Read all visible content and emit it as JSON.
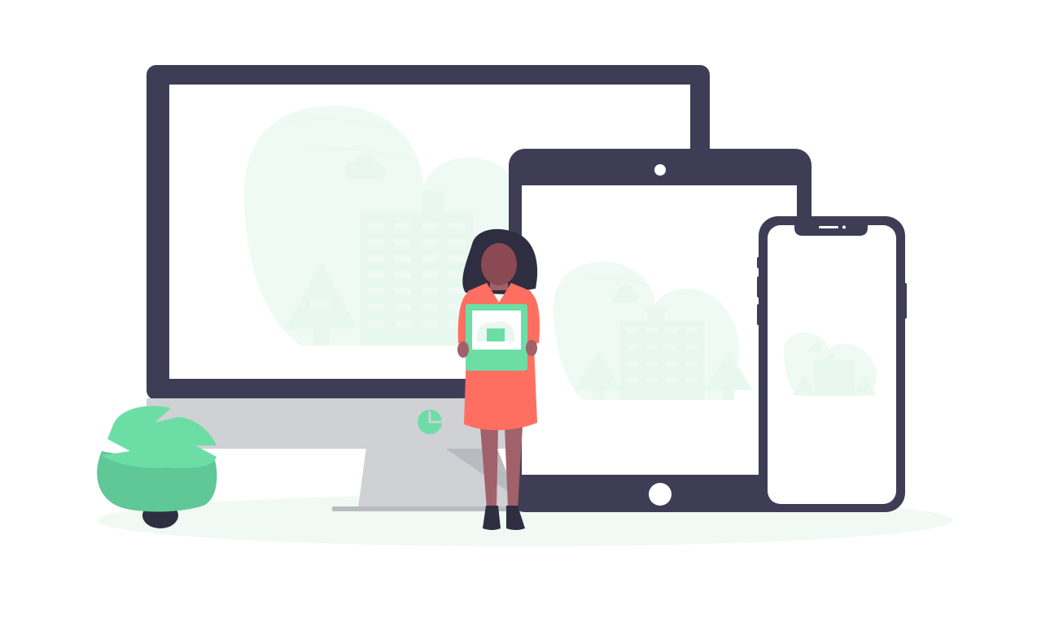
{
  "illustration": {
    "subject": "responsive-devices",
    "devices": [
      "desktop-monitor",
      "tablet",
      "smartphone"
    ],
    "figure": "woman-holding-picture-frame",
    "decor": [
      "potted-plant",
      "ground-shadow",
      "cloud-icon",
      "building-icon",
      "tree-icon"
    ]
  },
  "colors": {
    "background": "#ffffff",
    "device_frame": "#3f3d56",
    "device_screen": "#ffffff",
    "monitor_chin": "#d0d1d5",
    "monitor_stand": "#d0d1d5",
    "stand_shadow": "#b9bbc1",
    "accent": "#6ddda6",
    "accent_dark": "#5fc896",
    "accent_light": "#e8f8ef",
    "accent_faint": "#f0faf4",
    "ground": "#f0f9f3",
    "dress": "#ff6f61",
    "skin": "#a0616a",
    "hair": "#2f2e41",
    "face": "#8b4a53",
    "shoe": "#2f2e41"
  }
}
